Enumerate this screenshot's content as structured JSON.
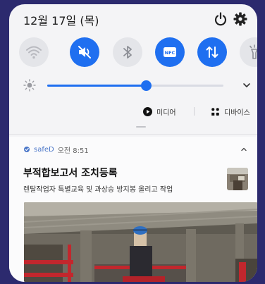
{
  "status_bar": {
    "date": "12월 17일 (목)"
  },
  "quick_toggles": [
    {
      "name": "wifi",
      "icon": "wifi-icon",
      "state": "off"
    },
    {
      "name": "sound",
      "icon": "mute-icon",
      "state": "on"
    },
    {
      "name": "bluetooth",
      "icon": "bluetooth-icon",
      "state": "off"
    },
    {
      "name": "nfc",
      "icon": "nfc-icon",
      "state": "on",
      "text": "NFC"
    },
    {
      "name": "mobile-data",
      "icon": "data-transfer-icon",
      "state": "on"
    },
    {
      "name": "flashlight",
      "icon": "flashlight-icon",
      "state": "off"
    }
  ],
  "brightness": {
    "level": 0.56
  },
  "media_controls": {
    "media_label": "미디어",
    "devices_label": "디바이스"
  },
  "notification": {
    "app_name": "safeD",
    "time": "오전 8:51",
    "title": "부적합보고서 조치등록",
    "body": "렌탈작업자 특별교육 및 과상승 방지봉 올리고 작업"
  },
  "colors": {
    "accent": "#1f6ff0",
    "background": "#2c2a6e",
    "panel": "#f4f4f6"
  }
}
